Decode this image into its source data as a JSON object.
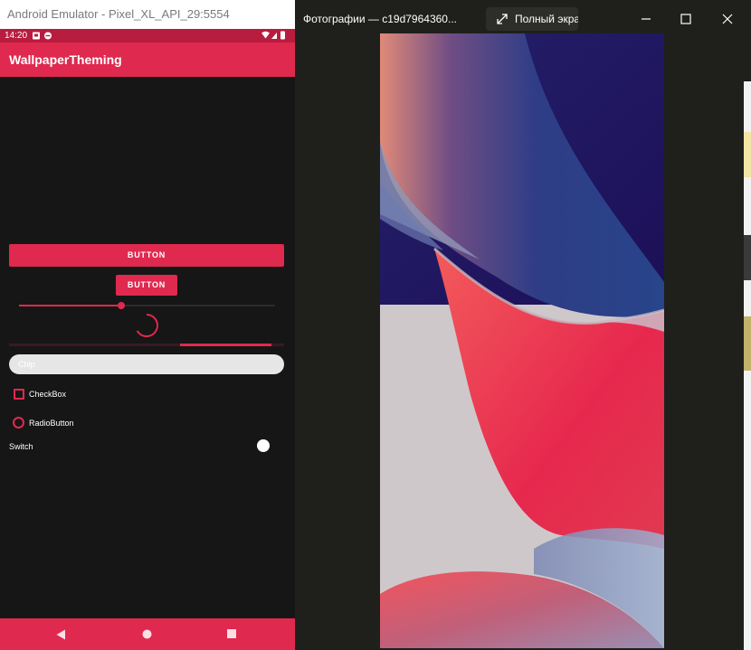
{
  "emulator": {
    "window_title": "Android Emulator - Pixel_XL_API_29:5554",
    "status_time": "14:20",
    "app_title": "WallpaperTheming",
    "button_wide": "BUTTON",
    "button_small": "BUTTON",
    "slider_value": 0.37,
    "progress_value": 0.95,
    "progress_secondary_start": 0.62,
    "chip_text": "Chip",
    "checkbox_label": "CheckBox",
    "radio_label": "RadioButton",
    "switch_label": "Switch",
    "accent_color": "#e0294f",
    "statusbar_color": "#b81c3e",
    "background_color": "#161616"
  },
  "photos": {
    "window_title": "Фотографии — c19d7964360...",
    "fullscreen_label": "Полный экран",
    "background_color": "#1f201c"
  }
}
